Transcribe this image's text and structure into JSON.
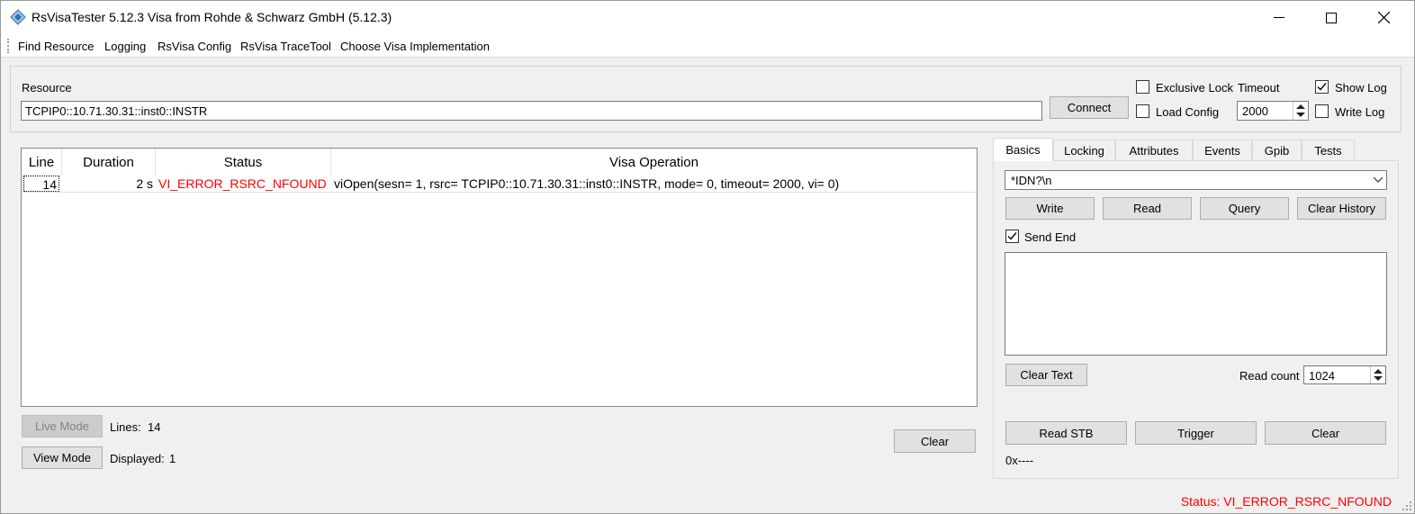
{
  "window": {
    "title": "RsVisaTester 5.12.3 Visa from Rohde & Schwarz GmbH (5.12.3)"
  },
  "menu": [
    "Find Resource",
    "Logging",
    "RsVisa Config",
    "RsVisa TraceTool",
    "Choose Visa Implementation"
  ],
  "resource": {
    "label": "Resource",
    "value": "TCPIP0::10.71.30.31::inst0::INSTR",
    "connect_label": "Connect",
    "exclusive_lock_label": "Exclusive Lock",
    "exclusive_lock_checked": false,
    "load_config_label": "Load Config",
    "load_config_checked": false,
    "timeout_label": "Timeout",
    "timeout_value": "2000",
    "show_log_label": "Show Log",
    "show_log_checked": true,
    "write_log_label": "Write Log",
    "write_log_checked": false
  },
  "log": {
    "columns": [
      "Line",
      "Duration",
      "Status",
      "Visa Operation"
    ],
    "rows": [
      {
        "line": "14",
        "duration": "2 s",
        "status": "VI_ERROR_RSRC_NFOUND",
        "operation": "viOpen(sesn= 1, rsrc= TCPIP0::10.71.30.31::inst0::INSTR, mode= 0, timeout= 2000, vi= 0)"
      }
    ],
    "status_error_color": "#ff0000"
  },
  "log_controls": {
    "live_mode_label": "Live Mode",
    "view_mode_label": "View Mode",
    "lines_label": "Lines:",
    "lines_value": "14",
    "displayed_label": "Displayed:",
    "displayed_value": "1",
    "clear_label": "Clear"
  },
  "tabs": [
    {
      "label": "Basics",
      "active": true
    },
    {
      "label": "Locking",
      "active": false
    },
    {
      "label": "Attributes",
      "active": false
    },
    {
      "label": "Events",
      "active": false
    },
    {
      "label": "Gpib",
      "active": false
    },
    {
      "label": "Tests",
      "active": false
    }
  ],
  "basics": {
    "command_value": "*IDN?\\n",
    "write_label": "Write",
    "read_label": "Read",
    "query_label": "Query",
    "clear_history_label": "Clear History",
    "send_end_label": "Send End",
    "send_end_checked": true,
    "clear_text_label": "Clear Text",
    "read_count_label": "Read count",
    "read_count_value": "1024",
    "read_stb_label": "Read STB",
    "trigger_label": "Trigger",
    "clear_label": "Clear",
    "stb_value": "0x----"
  },
  "statusbar": {
    "text": "Status: VI_ERROR_RSRC_NFOUND",
    "color": "#ff0000"
  }
}
